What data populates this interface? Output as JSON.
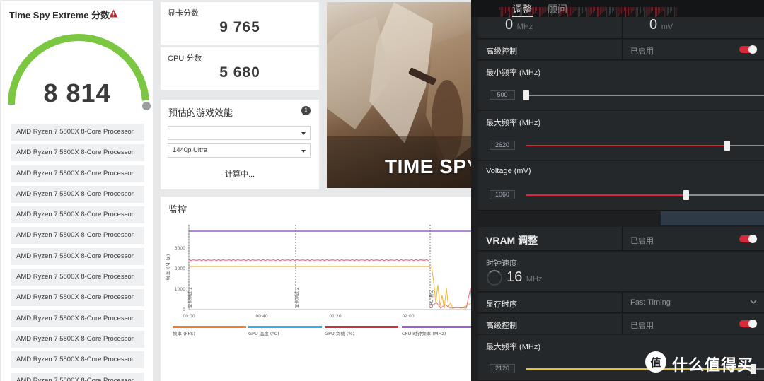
{
  "score": {
    "title": "Time Spy Extreme 分数",
    "value": "8 814",
    "gauge_fraction": 0.98,
    "cpu_items": [
      "AMD Ryzen 7 5800X 8-Core Processor",
      "AMD Ryzen 7 5800X 8-Core Processor",
      "AMD Ryzen 7 5800X 8-Core Processor",
      "AMD Ryzen 7 5800X 8-Core Processor",
      "AMD Ryzen 7 5800X 8-Core Processor",
      "AMD Ryzen 7 5800X 8-Core Processor",
      "AMD Ryzen 7 5800X 8-Core Processor",
      "AMD Ryzen 7 5800X 8-Core Processor",
      "AMD Ryzen 7 5800X 8-Core Processor",
      "AMD Ryzen 7 5800X 8-Core Processor",
      "AMD Ryzen 7 5800X 8-Core Processor",
      "AMD Ryzen 7 5800X 8-Core Processor",
      "AMD Ryzen 7 5800X 8-Core Processor"
    ],
    "colors": {
      "gauge": "#7bc742",
      "warning": "#c8262c"
    }
  },
  "gpu_score": {
    "label": "显卡分数",
    "value": "9 765"
  },
  "cpu_score": {
    "label": "CPU 分数",
    "value": "5 680"
  },
  "perf": {
    "title": "预估的游戏效能",
    "select_game": "",
    "select_setting": "1440p Ultra",
    "status": "计算中..."
  },
  "banner": {
    "text": "TIME SPY"
  },
  "monitor": {
    "title": "监控",
    "y_axis_label": "频率 (MHz)",
    "y_ticks": [
      "3000",
      "2000",
      "1000",
      "0"
    ],
    "x_ticks": [
      "00:00",
      "00:40",
      "01:20",
      "02:00"
    ],
    "markers": [
      "显卡测试 1",
      "显卡测试 2",
      "CPU 测试"
    ],
    "legend": [
      {
        "label": "帧率 (FPS)",
        "color": "#f07b2a"
      },
      {
        "label": "GPU 温度 (°C)",
        "color": "#27b3e6"
      },
      {
        "label": "GPU 负载 (%)",
        "color": "#d8283a"
      },
      {
        "label": "CPU 时钟频率 (MHz)",
        "color": "#9b5fc8"
      }
    ]
  },
  "amd": {
    "tabs": {
      "active": "调整",
      "other": "顾问"
    },
    "top_values": {
      "left": "0",
      "left_unit": "MHz",
      "right": "0",
      "right_unit": "mV"
    },
    "gpu_section": {
      "advanced_control_label": "高级控制",
      "advanced_control_value": "已启用",
      "min_freq_label": "最小频率 (MHz)",
      "min_freq_value": "500",
      "min_freq_fraction": 0.0,
      "max_freq_label": "最大频率 (MHz)",
      "max_freq_value": "2620",
      "max_freq_fraction": 0.84,
      "voltage_label": "Voltage (mV)",
      "voltage_value": "1060",
      "voltage_fraction": 0.67
    },
    "vram_section": {
      "title": "VRAM 调整",
      "status": "已启用",
      "clock_label": "时钟速度",
      "clock_value": "16",
      "clock_unit": "MHz",
      "timing_label": "显存时序",
      "timing_value": "Fast Timing",
      "advanced_control_label": "高级控制",
      "advanced_control_value": "已启用",
      "max_freq_label": "最大频率 (MHz)",
      "max_freq_value": "2120",
      "max_freq_fraction": 0.95
    },
    "colors": {
      "accent": "#d8283a",
      "vram_accent": "#e8c22c"
    }
  },
  "watermark": {
    "text": "什么值得买"
  }
}
